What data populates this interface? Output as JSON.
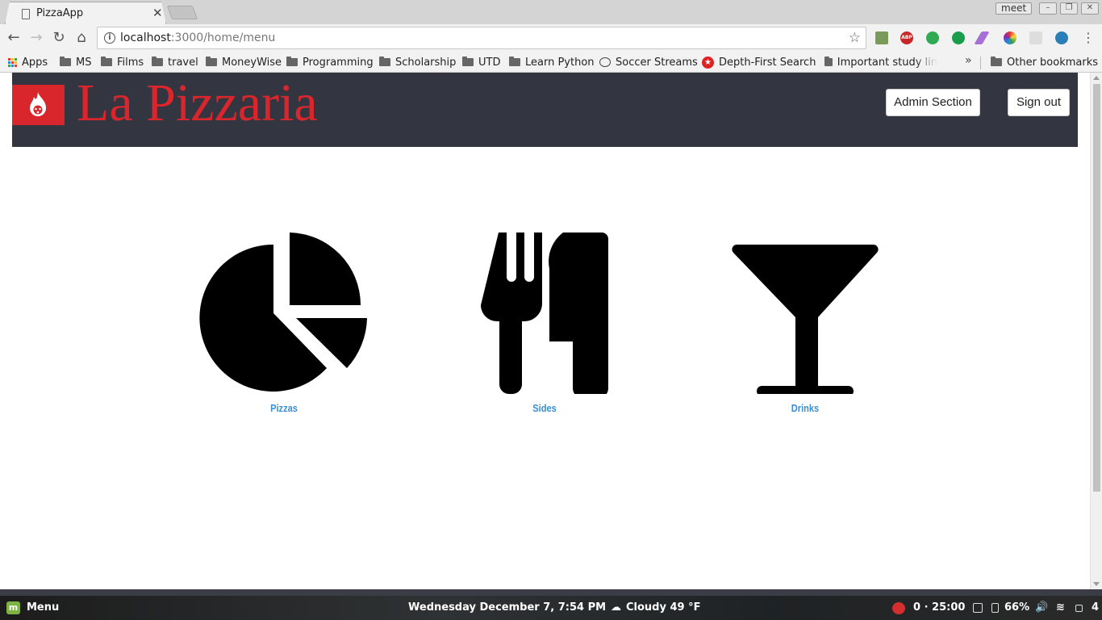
{
  "browser": {
    "tab_title": "PizzaApp",
    "profile_name": "meet",
    "url_host": "localhost",
    "url_path": ":3000/home/menu"
  },
  "bookmarks": {
    "apps": "Apps",
    "items": [
      "MS",
      "Films",
      "travel",
      "MoneyWise",
      "Programming",
      "Scholarship",
      "UTD",
      "Learn Python",
      "Soccer Streams",
      "Depth-First Search",
      "Important study lin"
    ],
    "other": "Other bookmarks"
  },
  "header": {
    "brand": "La Pizzaria",
    "admin_button": "Admin Section",
    "signout_button": "Sign out",
    "brand_color": "#d8262c",
    "bg_color": "#333641"
  },
  "menu": {
    "items": [
      {
        "label": "Pizzas",
        "icon": "pie-chart-icon"
      },
      {
        "label": "Sides",
        "icon": "fork-knife-icon"
      },
      {
        "label": "Drinks",
        "icon": "cocktail-glass-icon"
      }
    ],
    "link_color": "#3a8fd5"
  },
  "taskbar": {
    "menu_label": "Menu",
    "datetime": "Wednesday December  7,  7:54 PM",
    "weather": "Cloudy 49 °F",
    "pomodoro": "0 · 25:00",
    "battery": "66%",
    "workspace": "4"
  }
}
